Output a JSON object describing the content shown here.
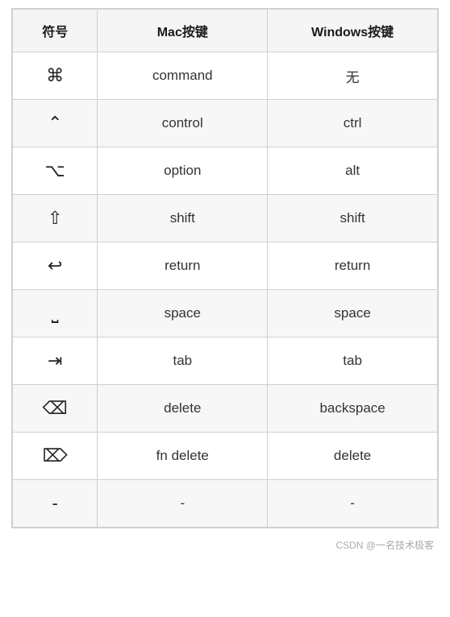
{
  "table": {
    "headers": {
      "symbol": "符号",
      "mac": "Mac按键",
      "windows": "Windows按键"
    },
    "rows": [
      {
        "symbol": "⌘",
        "mac": "command",
        "windows": "无"
      },
      {
        "symbol": "⌃",
        "mac": "control",
        "windows": "ctrl"
      },
      {
        "symbol": "⌥",
        "mac": "option",
        "windows": "alt"
      },
      {
        "symbol": "⇧",
        "mac": "shift",
        "windows": "shift"
      },
      {
        "symbol": "↩",
        "mac": "return",
        "windows": "return"
      },
      {
        "symbol": "⎵",
        "mac": "space",
        "windows": "space"
      },
      {
        "symbol": "⇥",
        "mac": "tab",
        "windows": "tab"
      },
      {
        "symbol": "⌫",
        "mac": "delete",
        "windows": "backspace"
      },
      {
        "symbol": "⌦",
        "mac": "fn delete",
        "windows": "delete"
      },
      {
        "symbol": "-",
        "mac": "-",
        "windows": "-"
      }
    ]
  },
  "watermark": "CSDN @一名技术极客"
}
